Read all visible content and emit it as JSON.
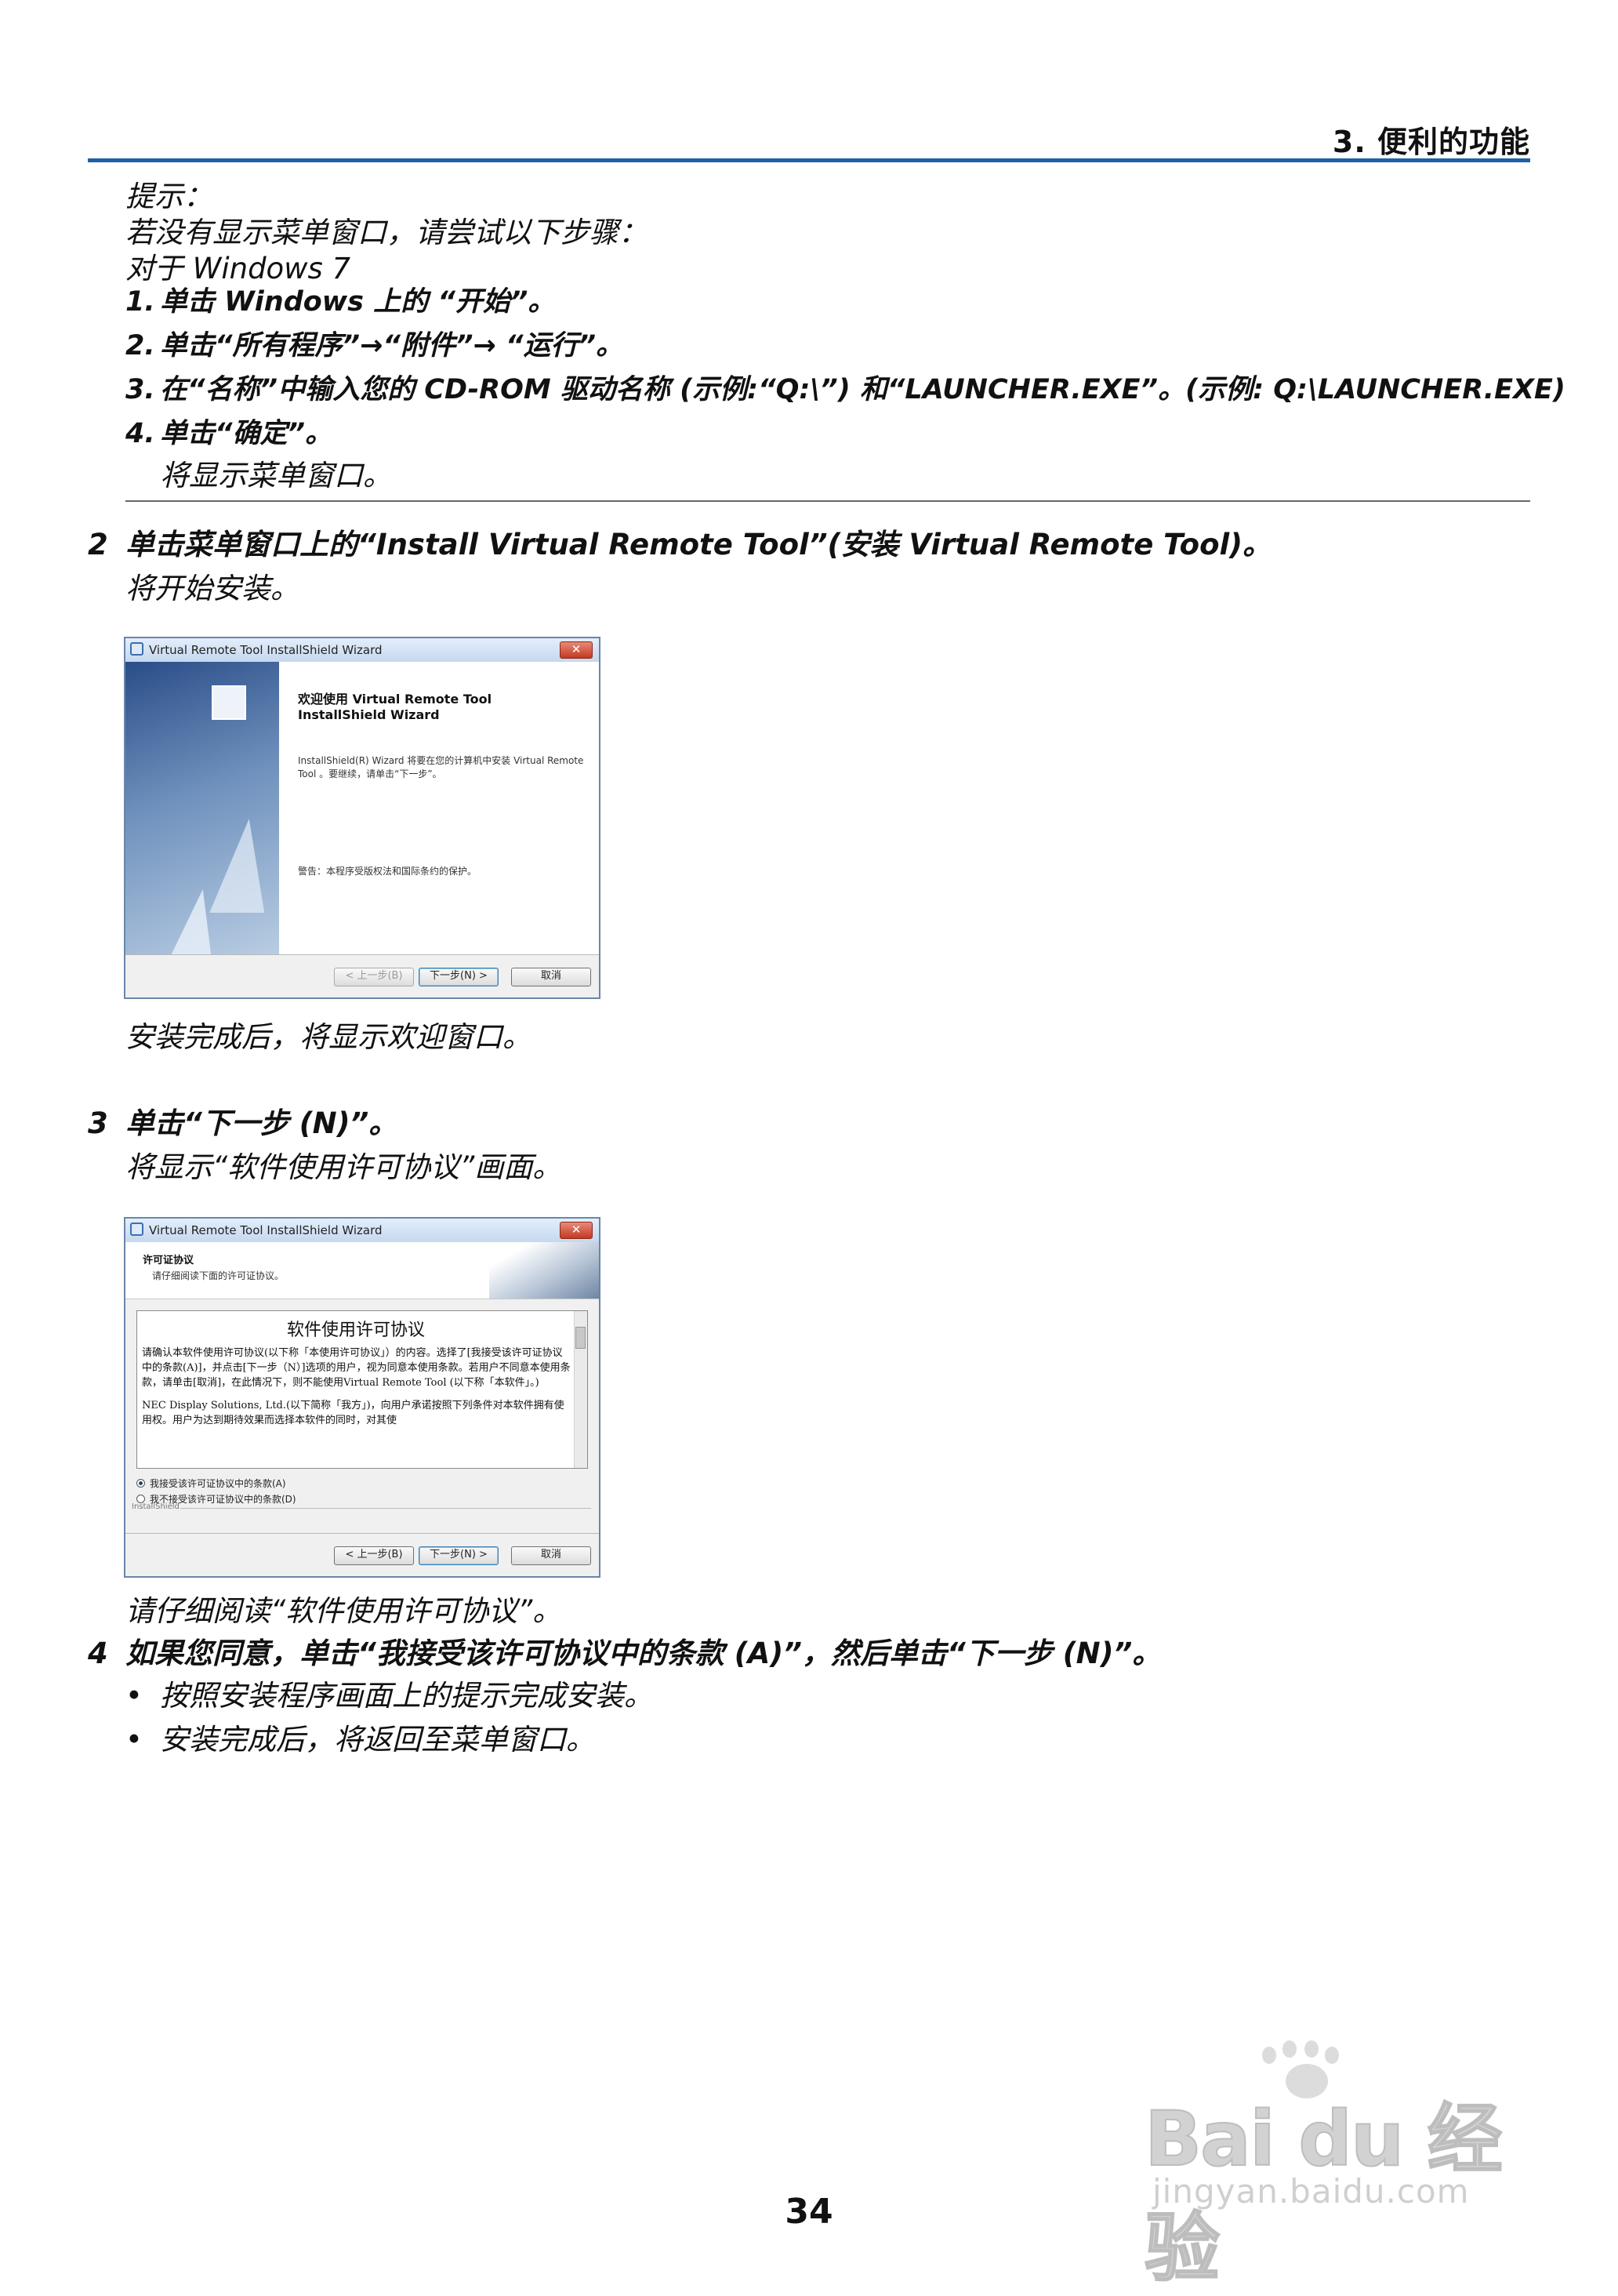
{
  "header": {
    "title": "3. 便利的功能"
  },
  "tip": {
    "label": "提示：",
    "line1": "若没有显示菜单窗口，请尝试以下步骤：",
    "line2": "对于 Windows 7",
    "steps": [
      {
        "num": "1.",
        "text": "单击 Windows 上的 “开始”。"
      },
      {
        "num": "2.",
        "text": "单击“所有程序”→“附件”→ “运行”。"
      },
      {
        "num": "3.",
        "text": "在“名称”中输入您的 CD-ROM 驱动名称 (示例:“Q:\\”) 和“LAUNCHER.EXE”。(示例: Q:\\LAUNCHER.EXE)"
      },
      {
        "num": "4.",
        "text": "单击“确定”。"
      }
    ],
    "result": "将显示菜单窗口。"
  },
  "step2": {
    "num": "2",
    "text": "单击菜单窗口上的“Install Virtual Remote Tool”(安装 Virtual Remote Tool)。",
    "sub": "将开始安装。",
    "after": "安装完成后，将显示欢迎窗口。"
  },
  "window1": {
    "title": "Virtual Remote Tool InstallShield Wizard",
    "close": "✕",
    "heading": "欢迎使用 Virtual Remote Tool InstallShield Wizard",
    "desc": "InstallShield(R) Wizard 将要在您的计算机中安装 Virtual Remote Tool 。要继续，请单击“下一步”。",
    "warning": "警告：本程序受版权法和国际条约的保护。",
    "btn_back": "< 上一步(B)",
    "btn_next": "下一步(N) >",
    "btn_cancel": "取消"
  },
  "step3": {
    "num": "3",
    "text": "单击“下一步 (N)”。",
    "sub": "将显示“软件使用许可协议”画面。",
    "after": "请仔细阅读“软件使用许可协议”。"
  },
  "window2": {
    "title": "Virtual Remote Tool InstallShield Wizard",
    "close": "✕",
    "head1": "许可证协议",
    "head2": "请仔细阅读下面的许可证协议。",
    "license_title": "软件使用许可协议",
    "license_p1": "请确认本软件使用许可协议(以下称「本使用许可协议」）的内容。选择了[我接受该许可证协议中的条款(A)]，并点击[下一步（N）]选项的用户，视为同意本使用条款。若用户不同意本使用条款，请单击[取消]，在此情况下，则不能使用Virtual Remote Tool (以下称「本软件」。)",
    "license_p2": "NEC Display Solutions, Ltd.(以下简称「我方」)，向用户承诺按照下列条件对本软件拥有使用权。用户为达到期待效果而选择本软件的同时，对其使",
    "radio_accept": "我接受该许可证协议中的条款(A)",
    "radio_decline": "我不接受该许可证协议中的条款(D)",
    "installshield": "InstallShield",
    "btn_back": "< 上一步(B)",
    "btn_next": "下一步(N) >",
    "btn_cancel": "取消"
  },
  "step4": {
    "num": "4",
    "text": "如果您同意，单击“我接受该许可协议中的条款 (A)”，然后单击“下一步 (N)”。",
    "bullets": [
      "按照安装程序画面上的提示完成安装。",
      "安装完成后，将返回至菜单窗口。"
    ]
  },
  "page_number": "34",
  "watermark": {
    "brand": "Bai du 经验",
    "site": "jingyan.baidu.com"
  },
  "colors": {
    "header_rule": "#1f5fa8",
    "close_button": "#c33a22"
  }
}
